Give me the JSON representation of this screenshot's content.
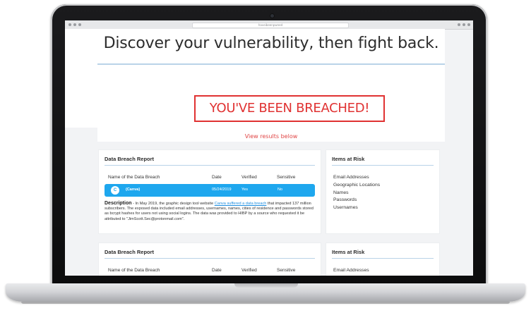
{
  "browser": {
    "url": "haveibeenpwned"
  },
  "hero": {
    "headline": "Discover your vulnerability, then fight back.",
    "alert": "YOU'VE BEEN BREACHED!",
    "view_results": "View results below"
  },
  "report": {
    "title": "Data Breach Report",
    "columns": {
      "name": "Name of the Data Breach",
      "date": "Date",
      "verified": "Verified",
      "sensitive": "Sensitive"
    },
    "row": {
      "icon": "canva-icon",
      "name": "(Canva)",
      "date": "05/24/2019",
      "verified": "Yes",
      "sensitive": "No"
    },
    "description": {
      "label": "Description",
      "text_before": " - In May 2019, the graphic design tool website ",
      "link": "Canva suffered a data breach",
      "text_after": " that impacted 137 million subscribers. The exposed data included email addresses, usernames, names, cities of residence and passwords stored as bcrypt hashes for users not using social logins. The data was provided to HIBP by a source who requested it be attributed to \"JimScott.Sec@protonmail.com\"."
    },
    "row_color": "#1ea7ee"
  },
  "risk": {
    "title": "Items at Risk",
    "items": [
      "Email Addresses",
      "Geographic Locations",
      "Names",
      "Passwords",
      "Usernames"
    ]
  },
  "report2": {
    "title": "Data Breach Report",
    "columns": {
      "name": "Name of the Data Breach",
      "date": "Date",
      "verified": "Verified",
      "sensitive": "Sensitive"
    }
  },
  "risk2": {
    "title": "Items at Risk",
    "items": [
      "Email Addresses"
    ]
  },
  "colors": {
    "alert_red": "#e03232",
    "accent_blue": "#1ea7ee",
    "rule_blue": "#b9d3e8"
  }
}
